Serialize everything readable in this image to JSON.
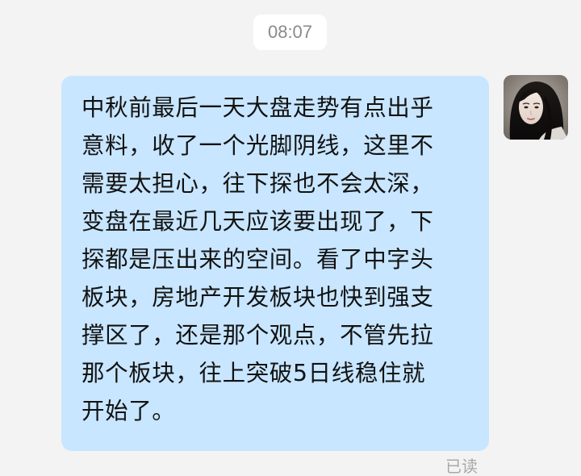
{
  "chat": {
    "timestamp": "08:07",
    "message": {
      "text": "中秋前最后一天大盘走势有点出乎意料，收了一个光脚阴线，这里不需要太担心，往下探也不会太深，变盘在最近几天应该要出现了，下探都是压出来的空间。看了中字头板块，房地产开发板块也快到强支撑区了，还是那个观点，不管先拉那个板块，往上突破5日线稳住就开始了。",
      "lines": [
        "中秋前最后一天大盘走势有点出乎",
        "意料，收了一个光脚阴线，这里不",
        "需要太担心，往下探也不会太深，",
        "变盘在最近几天应该要出现了，下",
        "探都是压出来的空间。看了中字头",
        "板块，房地产开发板块也快到强支",
        "撑区了，还是那个观点，不管先拉",
        "那个板块，往上突破5日线稳住就",
        "开始了。"
      ],
      "read_status": "已读",
      "bubble_color": "#c8e6ff"
    },
    "avatar": {
      "icon": "user-avatar-photo"
    },
    "background_color": "#f3f3f3"
  }
}
